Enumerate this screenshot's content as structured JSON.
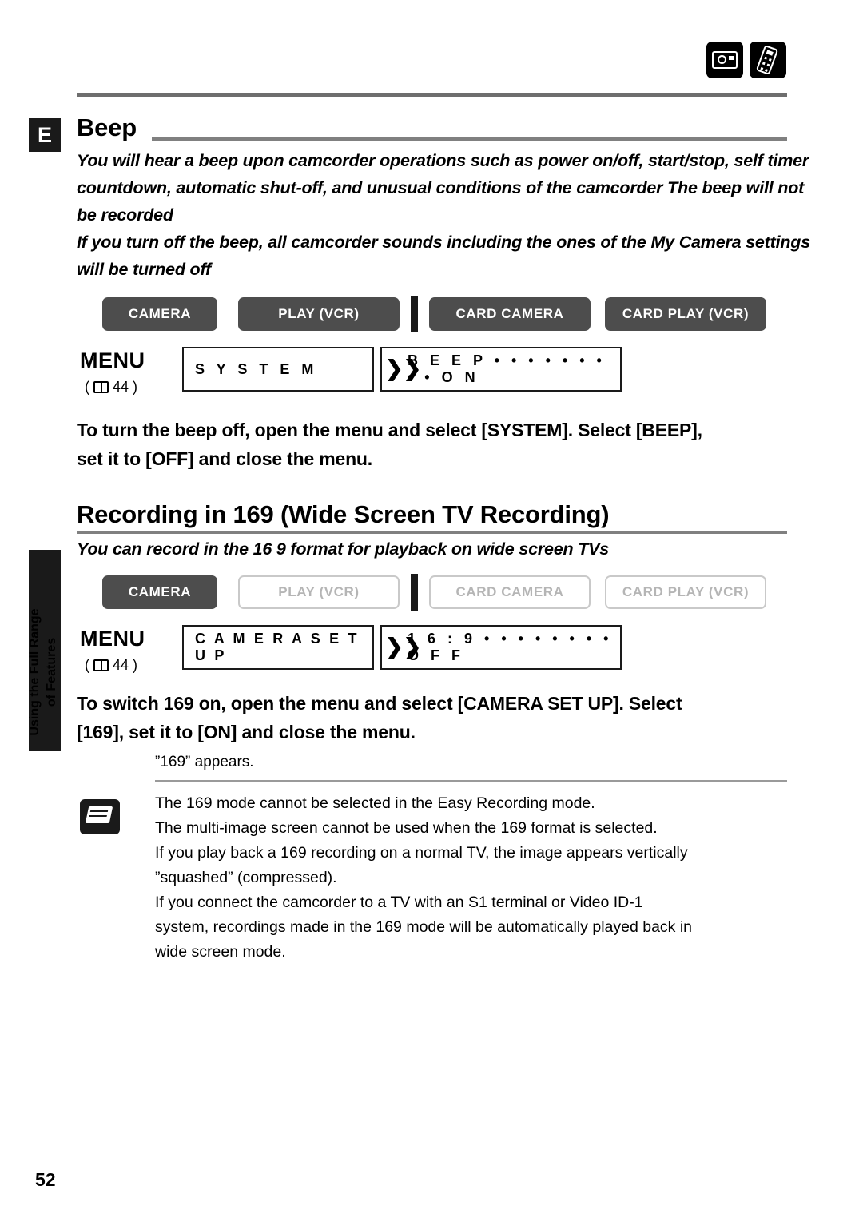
{
  "page": {
    "number": "52",
    "edition_tab": "E",
    "side_tab_line1": "Using the Full Range",
    "side_tab_line2": "of Features"
  },
  "mode_icons": [
    {
      "name": "camcorder-icon"
    },
    {
      "name": "remote-icon"
    }
  ],
  "sections": [
    {
      "id": "beep",
      "heading": "Beep",
      "intro": "You will hear a beep upon camcorder operations such as power on/off, start/stop, self timer countdown, automatic shut-off, and unusual conditions of the camcorder  The beep will not be recorded\nIf you turn off the beep, all camcorder sounds including the ones of the My Camera settings will be turned off",
      "modes": [
        {
          "label": "CAMERA",
          "state": "on"
        },
        {
          "label": "PLAY (VCR)",
          "state": "on"
        },
        {
          "label": "CARD CAMERA",
          "state": "on"
        },
        {
          "label": "CARD PLAY (VCR)",
          "state": "on"
        }
      ],
      "menu": {
        "word": "MENU",
        "ref": "44",
        "box1": "S Y S T E M",
        "box2": "B E E P • • • • • • • • • O N"
      },
      "instruction": "To turn the beep off, open the menu and select [SYSTEM]. Select [BEEP],\nset it to [OFF] and close the menu."
    },
    {
      "id": "wide-screen",
      "heading": "Recording in 169 (Wide Screen TV Recording)",
      "intro": "You can record in the 16 9 format for playback on wide screen TVs",
      "modes": [
        {
          "label": "CAMERA",
          "state": "on"
        },
        {
          "label": "PLAY (VCR)",
          "state": "off"
        },
        {
          "label": "CARD CAMERA",
          "state": "off"
        },
        {
          "label": "CARD PLAY (VCR)",
          "state": "off"
        }
      ],
      "menu": {
        "word": "MENU",
        "ref": "44",
        "box1": "C A M E R A   S E T   U P",
        "box2": "1 6 : 9 • • • • • • • • O F F"
      },
      "instruction": "To switch 169 on, open the menu and select [CAMERA SET UP]. Select\n[169], set it to [ON] and close the menu.",
      "sub_note": "”169” appears."
    }
  ],
  "notes": {
    "icon": "notes-pencil-icon",
    "items": [
      "The 169 mode cannot be selected in the Easy Recording mode.",
      "The multi-image screen cannot be used when the 169 format is selected.",
      "If you play back a 169 recording on a normal TV, the image appears vertically\n”squashed” (compressed).",
      "If you connect the camcorder to a TV with an S1 terminal or Video ID-1\nsystem, recordings made in the 169 mode will be automatically played back in\nwide screen mode."
    ]
  }
}
